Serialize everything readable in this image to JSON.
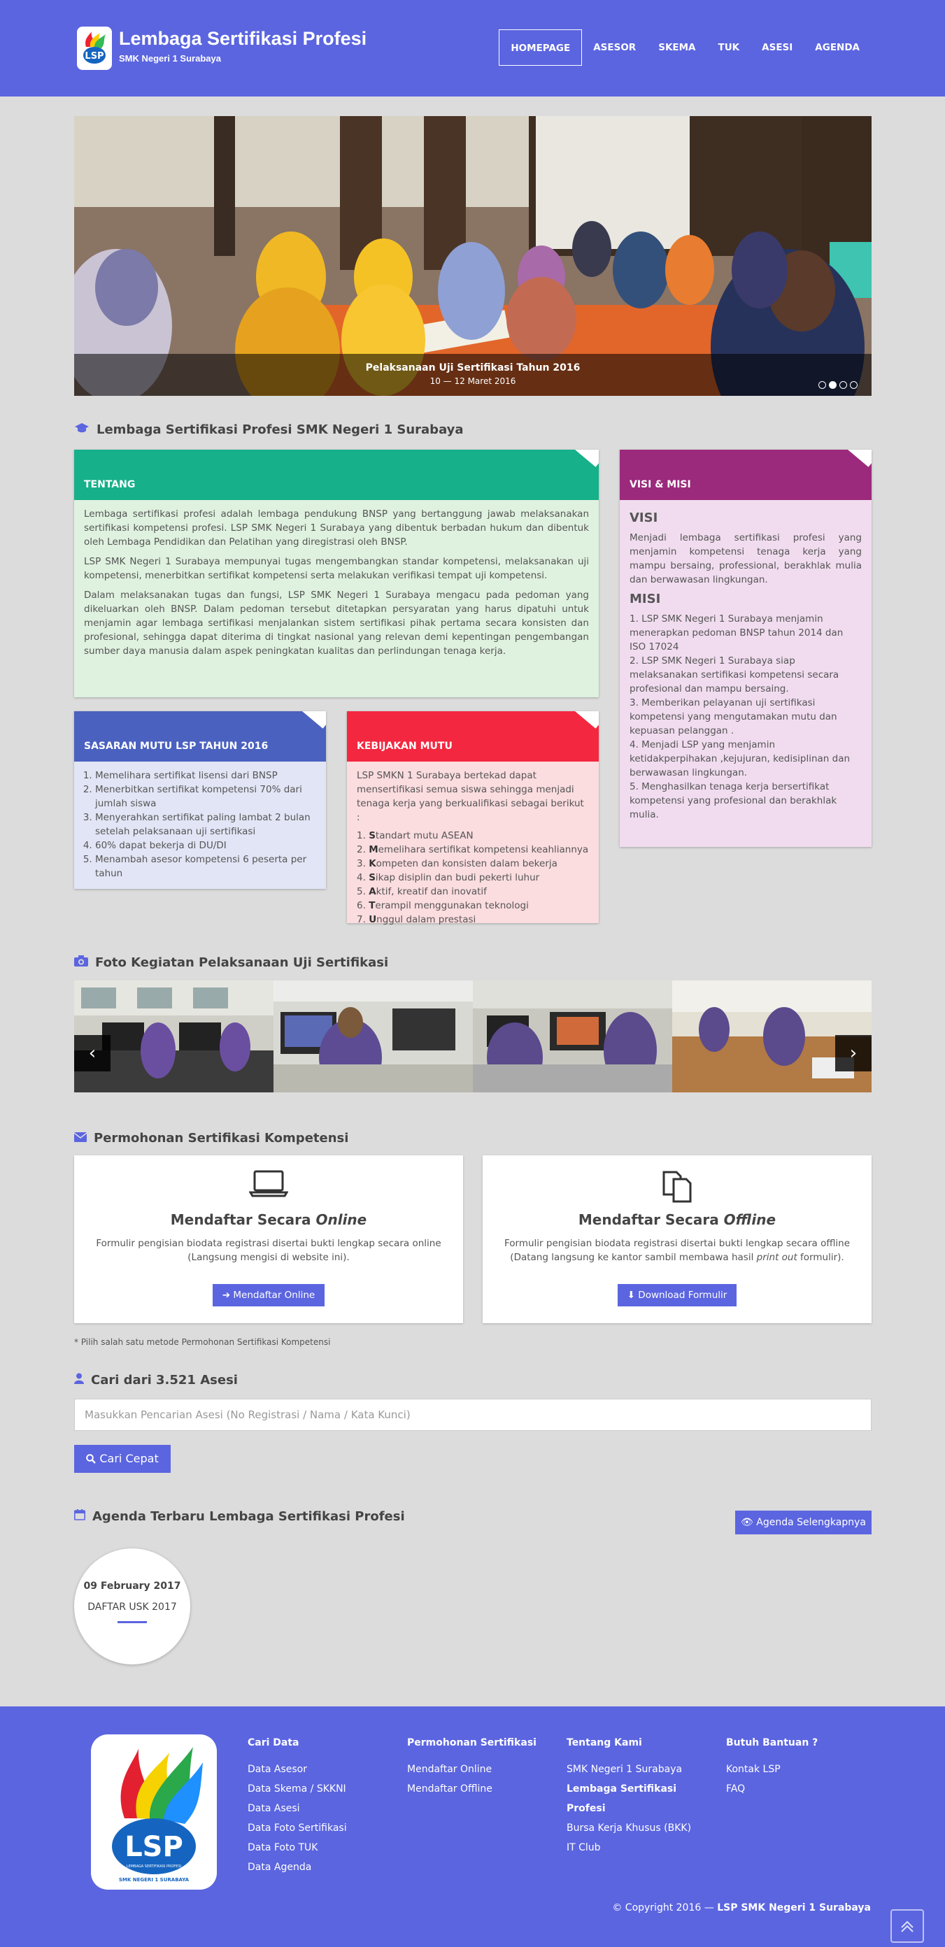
{
  "brand": {
    "title": "Lembaga Sertifikasi Profesi",
    "subtitle": "SMK Negeri 1 Surabaya",
    "accent": "#5b65e0"
  },
  "nav": [
    "HOMEPAGE",
    "ASESOR",
    "SKEMA",
    "TUK",
    "ASESI",
    "AGENDA"
  ],
  "slider": {
    "caption": "Pelaksanaan Uji Sertifikasi Tahun 2016",
    "date": "10 — 12 Maret 2016",
    "slides": 4,
    "active": 1
  },
  "lsp": {
    "heading": "Lembaga Sertifikasi Profesi SMK Negeri 1 Surabaya",
    "tentang": {
      "title": "TENTANG",
      "paragraphs": [
        "Lembaga sertifikasi profesi adalah lembaga pendukung BNSP yang bertanggung jawab melaksanakan sertifikasi kompetensi profesi. LSP SMK Negeri 1 Surabaya yang dibentuk berbadan hukum dan dibentuk oleh Lembaga Pendidikan dan Pelatihan yang diregistrasi oleh BNSP.",
        "LSP SMK Negeri 1 Surabaya mempunyai tugas mengembangkan standar kompetensi, melaksanakan uji kompetensi, menerbitkan sertifikat kompetensi serta melakukan verifikasi tempat uji kompetensi.",
        "Dalam melaksanakan tugas dan fungsi, LSP SMK Negeri 1 Surabaya mengacu pada pedoman yang dikeluarkan oleh BNSP. Dalam pedoman tersebut ditetapkan persyaratan yang harus dipatuhi untuk menjamin agar lembaga sertifikasi menjalankan sistem sertifikasi pihak pertama secara konsisten dan profesional, sehingga dapat diterima di tingkat nasional yang relevan demi kepentingan pengembangan sumber daya manusia dalam aspek peningkatan kualitas dan perlindungan tenaga kerja."
      ]
    },
    "visimisi": {
      "title": "VISI & MISI",
      "visi_h": "VISI",
      "visi": "Menjadi lembaga sertifikasi profesi yang menjamin kompetensi tenaga kerja yang mampu bersaing, professional, berakhlak mulia dan berwawasan lingkungan.",
      "misi_h": "MISI",
      "misi": [
        "1. LSP SMK Negeri 1 Surabaya menjamin menerapkan pedoman BNSP tahun 2014 dan ISO 17024",
        "2. LSP SMK Negeri 1 Surabaya siap melaksanakan sertifikasi kompetensi secara profesional dan mampu bersaing.",
        "3. Memberikan pelayanan uji sertifikasi kompetensi yang mengutamakan mutu dan kepuasan pelanggan .",
        "4. Menjadi LSP yang menjamin ketidakperpihakan ,kejujuran, kedisiplinan dan berwawasan lingkungan.",
        "5. Menghasilkan tenaga kerja bersertifikat kompetensi yang profesional dan berakhlak mulia."
      ]
    },
    "sasaran": {
      "title": "SASARAN MUTU LSP TAHUN 2016",
      "items": [
        "Memelihara sertifikat lisensi dari BNSP",
        "Menerbitkan sertifikat kompetensi 70% dari jumlah siswa",
        "Menyerahkan sertifikat paling lambat 2 bulan setelah pelaksanaan uji sertifikasi",
        "60% dapat bekerja di DU/DI",
        "Menambah asesor kompetensi 6 peserta per tahun"
      ]
    },
    "kebijakan": {
      "title": "KEBIJAKAN MUTU",
      "intro": "LSP SMKN 1 Surabaya bertekad dapat mensertifikasi semua siswa sehingga menjadi tenaga kerja yang berkualifikasi sebagai berikut :",
      "items": [
        {
          "n": "1.",
          "b": "S",
          "t": "tandart mutu ASEAN"
        },
        {
          "n": "2.",
          "b": "M",
          "t": "emelihara sertifikat kompetensi keahliannya"
        },
        {
          "n": "3.",
          "b": "K",
          "t": "ompeten dan konsisten dalam bekerja"
        },
        {
          "n": "4.",
          "b": "S",
          "t": "ikap disiplin dan budi pekerti luhur"
        },
        {
          "n": "5.",
          "b": "A",
          "t": "ktif, kreatif dan inovatif"
        },
        {
          "n": "6.",
          "b": "T",
          "t": "erampil menggunakan teknologi"
        },
        {
          "n": "7.",
          "b": "U",
          "t": "nggul dalam prestasi"
        }
      ]
    },
    "colors": {
      "tentang": "#16b08a",
      "tentang_bg": "#dff1df",
      "visi": "#9b2a7c",
      "visi_bg": "#f1dcef",
      "sasaran": "#4a61bf",
      "sasaran_bg": "#e2e5f5",
      "kebijakan": "#f3273f",
      "kebijakan_bg": "#fbdcdf"
    }
  },
  "gallery": {
    "heading": "Foto Kegiatan Pelaksanaan Uji Sertifikasi"
  },
  "permohonan": {
    "heading": "Permohonan Sertifikasi Kompetensi",
    "online": {
      "title_a": "Mendaftar Secara ",
      "title_b": "Online",
      "text": "Formulir pengisian biodata registrasi disertai bukti lengkap secara online (Langsung mengisi di website ini).",
      "button": "Mendaftar Online"
    },
    "offline": {
      "title_a": "Mendaftar Secara ",
      "title_b": "Offline",
      "text_a": "Formulir pengisian biodata registrasi disertai bukti lengkap secara offline (Datang langsung ke kantor sambil membawa hasil ",
      "text_i": "print out",
      "text_b": " formulir).",
      "button": "Download Formulir"
    },
    "note": "* Pilih salah satu metode Permohonan Sertifikasi Kompetensi"
  },
  "cari": {
    "heading": "Cari dari 3.521 Asesi",
    "placeholder": "Masukkan Pencarian Asesi (No Registrasi / Nama / Kata Kunci)",
    "button": "Cari Cepat"
  },
  "agenda": {
    "heading": "Agenda Terbaru Lembaga Sertifikasi Profesi",
    "button": "Agenda Selengkapnya",
    "item": {
      "date": "09 February 2017",
      "title": "DAFTAR USK 2017"
    }
  },
  "footer": {
    "cols": [
      {
        "h": "Cari Data",
        "items": [
          "Data Asesor",
          "Data Skema / SKKNI",
          "Data Asesi",
          "Data Foto Sertifikasi",
          "Data Foto TUK",
          "Data Agenda"
        ]
      },
      {
        "h": "Permohonan Sertifikasi",
        "items": [
          "Mendaftar Online",
          "Mendaftar Offline"
        ]
      },
      {
        "h": "Tentang Kami",
        "items": [
          "SMK Negeri 1 Surabaya",
          "Lembaga Sertifikasi Profesi",
          "Bursa Kerja Khusus (BKK)",
          "IT Club"
        ]
      },
      {
        "h": "Butuh Bantuan ?",
        "items": [
          "Kontak LSP",
          "FAQ"
        ]
      }
    ],
    "copyright_a": "© Copyright 2016 — ",
    "copyright_b": "LSP SMK Negeri 1 Surabaya",
    "logo_text": "LSP",
    "logo_ribbon": "LEMBAGA SERTIFIKASI PROFESI",
    "logo_school": "SMK NEGERI 1 SURABAYA"
  }
}
